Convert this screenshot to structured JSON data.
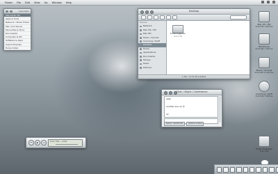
{
  "menubar": {
    "items": [
      "Finder",
      "File",
      "Edit",
      "View",
      "Go",
      "Window",
      "Help"
    ]
  },
  "list_widget": {
    "header": "Calculator",
    "items": [
      "Macintosh HD",
      "Apps & Tools",
      "Network / Share Folder",
      "Mac mini Server",
      "Favourites & Docs",
      "Documents",
      "Computer & HD",
      "Software & Apps",
      "Airport Express",
      "Home folder"
    ]
  },
  "finder": {
    "title": "Desktop",
    "sidebar_header_devices": "Devices",
    "sidebar_items": [
      "Network",
      "Mac OS / HD",
      "Mac HD",
      "Music / Sounds",
      "Incoming / Stuff",
      "Desktop",
      "Home",
      "Applications",
      "Documents",
      "Movies",
      "Music",
      "Pictures"
    ],
    "selected": "Desktop",
    "drive_label": "Fonte Organizer",
    "drive_sub": "Alias 4 KB",
    "status": "1 item, 24.43 GB available"
  },
  "chat": {
    "title": "Chat / iSight / Conference",
    "messages": [
      "spaz",
      "another line ok ☺",
      "ok"
    ],
    "footer_buttons": [
      "Setup / Update Me",
      "Options Linked"
    ]
  },
  "player": {
    "controls": [
      "⏮",
      "▶",
      "⏭"
    ],
    "lcd": "Track Title — Artist"
  },
  "desktop_icons": [
    {
      "label": "Mac OS / HD",
      "sub": "24.43 GB, 0 GB free"
    },
    {
      "label": "Workhorse",
      "sub": "24.43 GB, 4 GB free"
    },
    {
      "label": "Music / Sounds",
      "sub": "24.43 GB, 0.2 GB free"
    },
    {
      "label": "Incoming / Stuff",
      "sub": "24.43 GB, 3 GB free"
    },
    {
      "label": "Fonte Organizer",
      "sub": "Alias 4 KB"
    }
  ]
}
